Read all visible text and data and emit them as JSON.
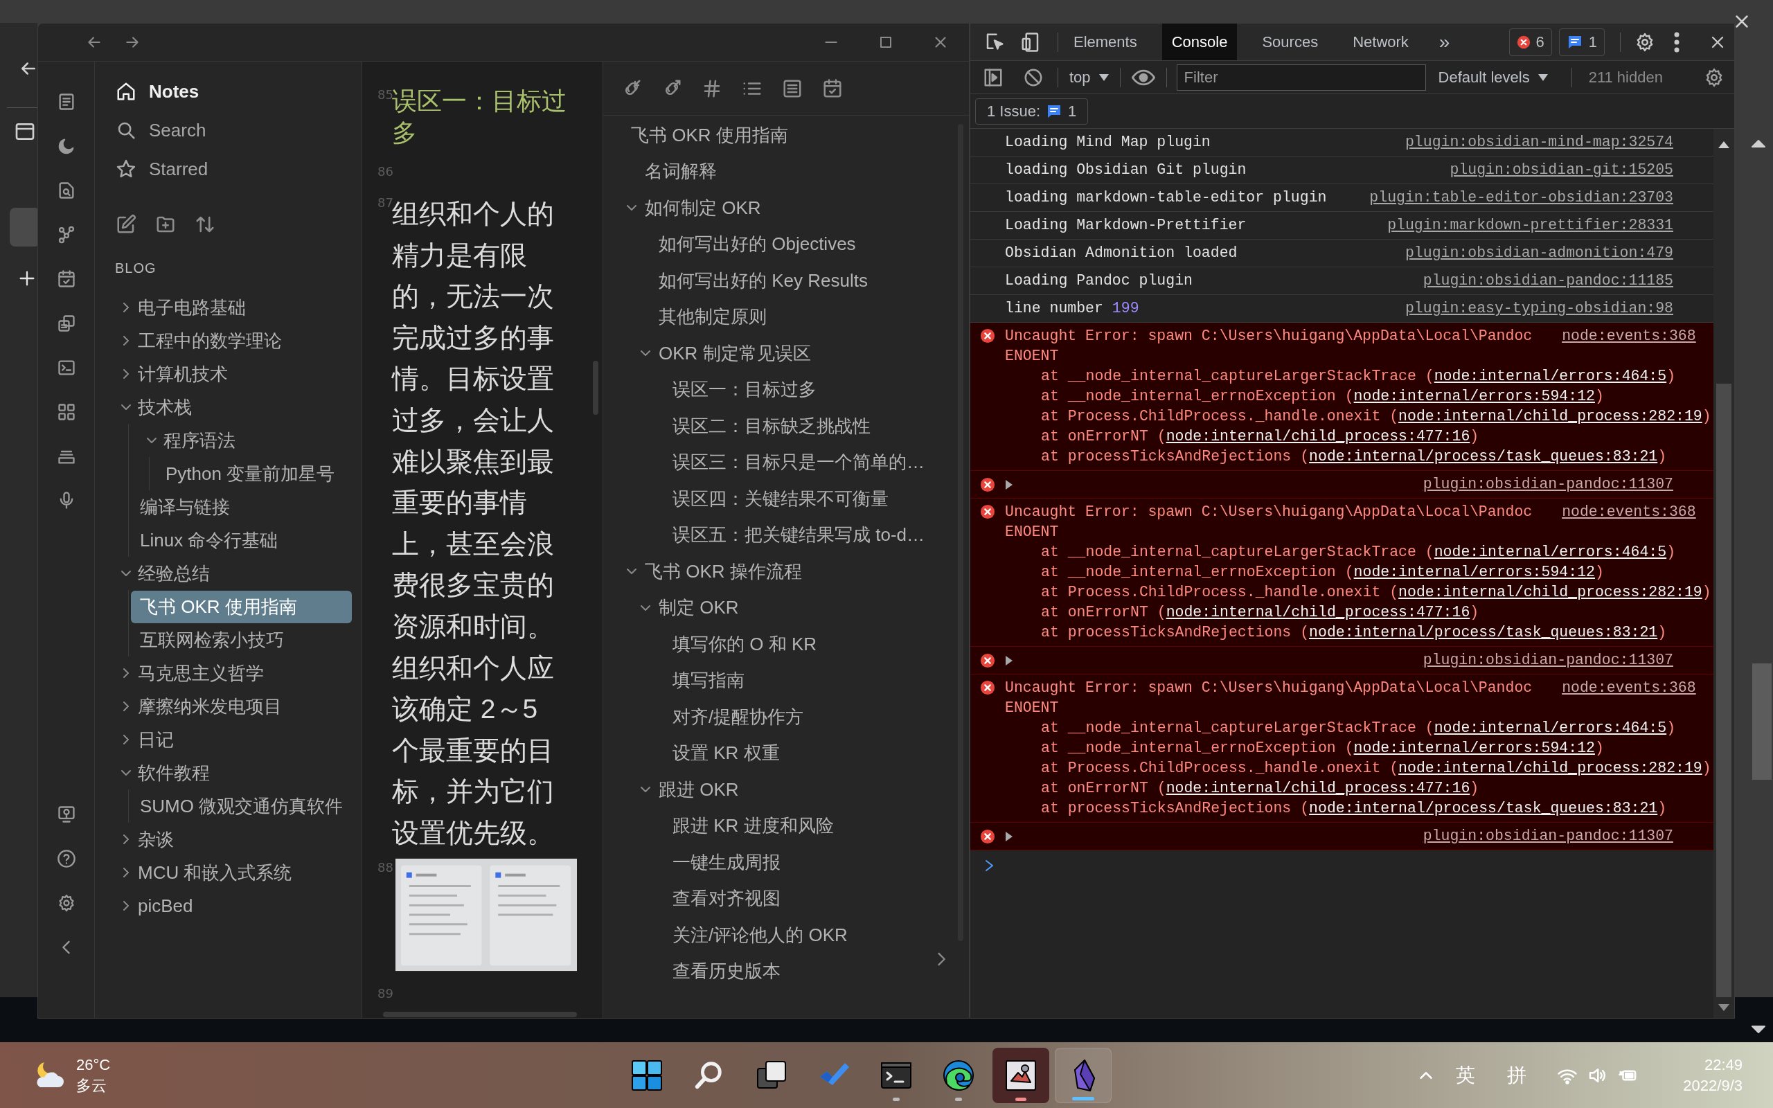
{
  "obsidian": {
    "explorer": {
      "nav": [
        {
          "label": "Notes",
          "selected": true
        },
        {
          "label": "Search",
          "selected": false
        },
        {
          "label": "Starred",
          "selected": false
        }
      ],
      "vault": "BLOG",
      "tree": [
        {
          "kind": "folder",
          "label": "电子电路基础",
          "expanded": false,
          "selected": false
        },
        {
          "kind": "folder",
          "label": "工程中的数学理论",
          "expanded": false,
          "selected": false
        },
        {
          "kind": "folder",
          "label": "计算机技术",
          "expanded": false,
          "selected": false
        },
        {
          "kind": "folder",
          "label": "技术栈",
          "expanded": true,
          "selected": false,
          "children": [
            {
              "kind": "folder",
              "label": "程序语法",
              "expanded": true,
              "selected": false,
              "children": [
                {
                  "kind": "file",
                  "label": "Python 变量前加星号",
                  "selected": false
                }
              ]
            },
            {
              "kind": "file",
              "label": "编译与链接",
              "selected": false
            },
            {
              "kind": "file",
              "label": "Linux 命令行基础",
              "selected": false
            }
          ]
        },
        {
          "kind": "folder",
          "label": "经验总结",
          "expanded": true,
          "selected": false,
          "children": [
            {
              "kind": "file",
              "label": "飞书 OKR 使用指南",
              "selected": true
            },
            {
              "kind": "file",
              "label": "互联网检索小技巧",
              "selected": false
            }
          ]
        },
        {
          "kind": "folder",
          "label": "马克思主义哲学",
          "expanded": false,
          "selected": false
        },
        {
          "kind": "folder",
          "label": "摩擦纳米发电项目",
          "expanded": false,
          "selected": false
        },
        {
          "kind": "folder",
          "label": "日记",
          "expanded": false,
          "selected": false
        },
        {
          "kind": "folder",
          "label": "软件教程",
          "expanded": true,
          "selected": false,
          "children": [
            {
              "kind": "file",
              "label": "SUMO 微观交通仿真软件",
              "selected": false
            }
          ]
        },
        {
          "kind": "folder",
          "label": "杂谈",
          "expanded": false,
          "selected": false
        },
        {
          "kind": "folder",
          "label": "MCU 和嵌入式系统",
          "expanded": false,
          "selected": false
        },
        {
          "kind": "folder",
          "label": "picBed",
          "expanded": false,
          "selected": false
        }
      ]
    },
    "editor": {
      "blocks": [
        {
          "kind": "heading",
          "line": "85",
          "text": "误区一：目标过多"
        },
        {
          "kind": "blank",
          "line": "86"
        },
        {
          "kind": "paragraph",
          "line": "87",
          "text": "组织和个人的精力是有限的，无法一次完成过多的事情。目标设置过多，会让人难以聚焦到最重要的事情上，甚至会浪费很多宝贵的资源和时间。组织和个人应该确定 2～5 个最重要的目标，并为它们设置优先级。"
        },
        {
          "line": "88"
        },
        {
          "kind": "blank",
          "line": "89"
        }
      ]
    },
    "outline": {
      "items": [
        {
          "text": "飞书 OKR 使用指南",
          "children": [
            {
              "text": "名词解释"
            },
            {
              "text": "如何制定 OKR",
              "expanded": true,
              "children": [
                {
                  "text": "如何写出好的 Objectives"
                },
                {
                  "text": "如何写出好的 Key Results"
                },
                {
                  "text": "其他制定原则"
                },
                {
                  "text": "OKR 制定常见误区",
                  "expanded": true,
                  "children": [
                    {
                      "text": "误区一：目标过多"
                    },
                    {
                      "text": "误区二：目标缺乏挑战性"
                    },
                    {
                      "text": "误区三：目标只是一个简单的…"
                    },
                    {
                      "text": "误区四：关键结果不可衡量"
                    },
                    {
                      "text": "误区五：把关键结果写成 to-d…"
                    }
                  ]
                }
              ]
            },
            {
              "text": "飞书 OKR 操作流程",
              "expanded": true,
              "children": [
                {
                  "text": "制定 OKR",
                  "expanded": true,
                  "children": [
                    {
                      "text": "填写你的 O 和 KR"
                    },
                    {
                      "text": "填写指南"
                    },
                    {
                      "text": "对齐/提醒协作方"
                    },
                    {
                      "text": "设置 KR 权重"
                    }
                  ]
                },
                {
                  "text": "跟进 OKR",
                  "expanded": true,
                  "children": [
                    {
                      "text": "跟进 KR 进度和风险"
                    },
                    {
                      "text": "一键生成周报"
                    },
                    {
                      "text": "查看对齐视图"
                    },
                    {
                      "text": "关注/评论他人的 OKR"
                    },
                    {
                      "text": "查看历史版本"
                    }
                  ]
                }
              ]
            }
          ]
        }
      ]
    }
  },
  "devtools": {
    "tabs": [
      {
        "label": "Elements",
        "selected": false
      },
      {
        "label": "Console",
        "selected": true
      },
      {
        "label": "Sources",
        "selected": false
      },
      {
        "label": "Network",
        "selected": false
      }
    ],
    "more": "»",
    "error_count": "6",
    "message_count": "1",
    "context": "top",
    "filter": {
      "placeholder": "Filter"
    },
    "levels": "Default levels",
    "hidden": "211 hidden",
    "issues": {
      "label": "1 Issue:",
      "count": "1"
    },
    "messages": [
      {
        "kind": "log",
        "text": "Loading Mind Map plugin",
        "source": "plugin:obsidian-mind-map:32574"
      },
      {
        "kind": "log",
        "text": "loading Obsidian Git plugin",
        "source": "plugin:obsidian-git:15205"
      },
      {
        "kind": "log",
        "text": "loading markdown-table-editor plugin",
        "source": "plugin:table-editor-obsidian:23703"
      },
      {
        "kind": "log",
        "text": "Loading Markdown-Prettifier",
        "source": "plugin:markdown-prettifier:28331"
      },
      {
        "kind": "log",
        "text": "Obsidian Admonition loaded",
        "source": "plugin:obsidian-admonition:479"
      },
      {
        "kind": "log",
        "text": "Loading Pandoc plugin",
        "source": "plugin:obsidian-pandoc:11185"
      },
      {
        "kind": "log",
        "text": "line number",
        "number": "199",
        "source": "plugin:easy-typing-obsidian:98"
      },
      {
        "kind": "error",
        "text": "Uncaught Error: spawn C:\\Users\\huigang\\AppData\\Local\\Pandoc ENOENT",
        "source": "node:events:368",
        "stack": [
          {
            "prefix": "at __node_internal_captureLargerStackTrace (",
            "location": "node:internal/errors:464:5",
            "suffix": ")"
          },
          {
            "prefix": "at __node_internal_errnoException (",
            "location": "node:internal/errors:594:12",
            "suffix": ")"
          },
          {
            "prefix": "at Process.ChildProcess._handle.onexit (",
            "location": "node:internal/child_process:282:19",
            "suffix": ")"
          },
          {
            "prefix": "at onErrorNT (",
            "location": "node:internal/child_process:477:16",
            "suffix": ")"
          },
          {
            "prefix": "at processTicksAndRejections (",
            "location": "node:internal/process/task_queues:83:21",
            "suffix": ")"
          }
        ]
      },
      {
        "kind": "error_group",
        "expanded": false,
        "source": "plugin:obsidian-pandoc:11307"
      },
      {
        "kind": "error",
        "text": "Uncaught Error: spawn C:\\Users\\huigang\\AppData\\Local\\Pandoc ENOENT",
        "source": "node:events:368",
        "stack": [
          {
            "prefix": "at __node_internal_captureLargerStackTrace (",
            "location": "node:internal/errors:464:5",
            "suffix": ")"
          },
          {
            "prefix": "at __node_internal_errnoException (",
            "location": "node:internal/errors:594:12",
            "suffix": ")"
          },
          {
            "prefix": "at Process.ChildProcess._handle.onexit (",
            "location": "node:internal/child_process:282:19",
            "suffix": ")"
          },
          {
            "prefix": "at onErrorNT (",
            "location": "node:internal/child_process:477:16",
            "suffix": ")"
          },
          {
            "prefix": "at processTicksAndRejections (",
            "location": "node:internal/process/task_queues:83:21",
            "suffix": ")"
          }
        ]
      },
      {
        "kind": "error_group",
        "expanded": false,
        "source": "plugin:obsidian-pandoc:11307"
      },
      {
        "kind": "error",
        "text": "Uncaught Error: spawn C:\\Users\\huigang\\AppData\\Local\\Pandoc ENOENT",
        "source": "node:events:368",
        "stack": [
          {
            "prefix": "at __node_internal_captureLargerStackTrace (",
            "location": "node:internal/errors:464:5",
            "suffix": ")"
          },
          {
            "prefix": "at __node_internal_errnoException (",
            "location": "node:internal/errors:594:12",
            "suffix": ")"
          },
          {
            "prefix": "at Process.ChildProcess._handle.onexit (",
            "location": "node:internal/child_process:282:19",
            "suffix": ")"
          },
          {
            "prefix": "at onErrorNT (",
            "location": "node:internal/child_process:477:16",
            "suffix": ")"
          },
          {
            "prefix": "at processTicksAndRejections (",
            "location": "node:internal/process/task_queues:83:21",
            "suffix": ")"
          }
        ]
      },
      {
        "kind": "error_group",
        "expanded": false,
        "source": "plugin:obsidian-pandoc:11307"
      }
    ]
  },
  "taskbar": {
    "weather": {
      "temperature": "26°C",
      "condition": "多云"
    },
    "apps": [
      {
        "kind": "start",
        "running": false,
        "attention": false,
        "focused": false
      },
      {
        "kind": "search",
        "running": false,
        "attention": false,
        "focused": false
      },
      {
        "kind": "task_view",
        "running": false,
        "attention": false,
        "focused": false
      },
      {
        "kind": "todo",
        "running": false,
        "attention": false,
        "focused": false
      },
      {
        "kind": "terminal",
        "running": true,
        "attention": false,
        "focused": false
      },
      {
        "kind": "browser",
        "running": true,
        "attention": false,
        "focused": false
      },
      {
        "kind": "photos",
        "running": true,
        "attention": true,
        "focused": false
      },
      {
        "kind": "notes",
        "running": true,
        "attention": false,
        "focused": true
      }
    ],
    "tray": {
      "input_language": "英",
      "input_mode": "拼",
      "time": "22:49",
      "date": "2022/9/3"
    }
  }
}
